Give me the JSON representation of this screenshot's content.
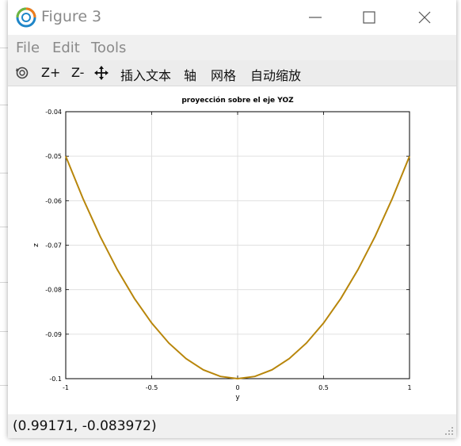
{
  "window": {
    "title": "Figure 3"
  },
  "menu": {
    "items": [
      "File",
      "Edit",
      "Tools"
    ]
  },
  "toolbar": {
    "rotate_icon": "rotate-icon",
    "zoom_in": "Z+",
    "zoom_out": "Z-",
    "pan_icon": "pan-icon",
    "insert_text": "插入文本",
    "axes": "轴",
    "grid": "网格",
    "autoscale": "自动缩放"
  },
  "status": {
    "coords": "(0.99171, -0.083972)"
  },
  "chart_data": {
    "type": "line",
    "title": "proyección sobre el eje YOZ",
    "xlabel": "y",
    "ylabel": "z",
    "xlim": [
      -1,
      1
    ],
    "ylim": [
      -0.1,
      -0.04
    ],
    "xticks": [
      "-1",
      "-0.5",
      "0",
      "0.5",
      "1"
    ],
    "yticks": [
      "-0.04",
      "-0.05",
      "-0.06",
      "-0.07",
      "-0.08",
      "-0.09",
      "-0.1"
    ],
    "grid": true,
    "series": [
      {
        "color": "#b8860b",
        "x": [
          -1,
          -0.9,
          -0.8,
          -0.7,
          -0.6,
          -0.5,
          -0.4,
          -0.3,
          -0.2,
          -0.1,
          0,
          0.1,
          0.2,
          0.3,
          0.4,
          0.5,
          0.6,
          0.7,
          0.8,
          0.9,
          1
        ],
        "y": [
          -0.05,
          -0.0595,
          -0.068,
          -0.0755,
          -0.082,
          -0.0875,
          -0.092,
          -0.0955,
          -0.098,
          -0.0995,
          -0.1,
          -0.0995,
          -0.098,
          -0.0955,
          -0.092,
          -0.0875,
          -0.082,
          -0.0755,
          -0.068,
          -0.0595,
          -0.05
        ]
      }
    ]
  }
}
